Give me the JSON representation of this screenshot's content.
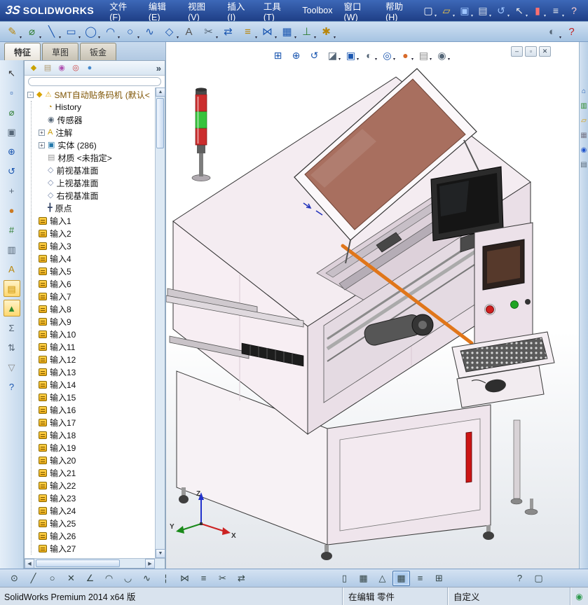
{
  "colors": {
    "titlebar_blue": "#2a4d9e",
    "toolbar_blue": "#b9cfe6",
    "viewport_bg": "#ffffff",
    "machine_pink": "#f4ecf1",
    "accent_orange": "#e0761a",
    "tower_red": "#cb2d2d",
    "tower_green": "#37c33c"
  },
  "titlebar": {
    "logo_mark": "3S",
    "logo_text": "SOLIDWORKS",
    "menus": [
      "文件(F)",
      "编辑(E)",
      "视图(V)",
      "插入(I)",
      "工具(T)",
      "Toolbox",
      "窗口(W)",
      "帮助(H)"
    ],
    "icons": [
      {
        "name": "new-document-icon",
        "glyph": "▢",
        "color": "#ffffff",
        "dd": true
      },
      {
        "name": "open-icon",
        "glyph": "▱",
        "color": "#f5c842",
        "dd": true
      },
      {
        "name": "save-icon",
        "glyph": "▣",
        "color": "#9cc4ff",
        "dd": true
      },
      {
        "name": "print-icon",
        "glyph": "▤",
        "color": "#d8e0ec",
        "dd": true
      },
      {
        "name": "undo-icon",
        "glyph": "↺",
        "color": "#9cc4ff",
        "dd": true
      },
      {
        "name": "select-icon",
        "glyph": "↖",
        "color": "#e8e8e8",
        "dd": true
      },
      {
        "name": "rebuild-icon",
        "glyph": "▮",
        "color": "#ff7070",
        "dd": true
      },
      {
        "name": "options-icon",
        "glyph": "≡",
        "color": "#f0f0f0",
        "dd": true
      },
      {
        "name": "help-badge-icon",
        "glyph": "?",
        "color": "#ffd0d0",
        "dd": false
      }
    ]
  },
  "toolbar2": {
    "icons": [
      {
        "name": "sketch-icon",
        "glyph": "✎",
        "color": "#b8860b",
        "dd": true
      },
      {
        "name": "smart-dimension-icon",
        "glyph": "⌀",
        "color": "#2e7d32",
        "dd": true
      },
      {
        "name": "line-icon",
        "glyph": "╲",
        "color": "#1a56b0",
        "dd": true
      },
      {
        "name": "rectangle-icon",
        "glyph": "▭",
        "color": "#1a56b0",
        "dd": true
      },
      {
        "name": "circle-icon",
        "glyph": "◯",
        "color": "#1a56b0",
        "dd": true
      },
      {
        "name": "arc-icon",
        "glyph": "◠",
        "color": "#1a56b0",
        "dd": true
      },
      {
        "name": "ellipse-icon",
        "glyph": "○",
        "color": "#1a56b0",
        "dd": true
      },
      {
        "name": "spline-icon",
        "glyph": "∿",
        "color": "#1a56b0",
        "dd": false
      },
      {
        "name": "polygon-icon",
        "glyph": "◇",
        "color": "#1a56b0",
        "dd": true
      },
      {
        "name": "text-icon",
        "glyph": "A",
        "color": "#555555",
        "dd": false
      },
      {
        "name": "trim-entities-icon",
        "glyph": "✂",
        "color": "#556677",
        "dd": true
      },
      {
        "name": "convert-entities-icon",
        "glyph": "⇄",
        "color": "#1a56b0",
        "dd": false
      },
      {
        "name": "offset-entities-icon",
        "glyph": "≡",
        "color": "#b8860b",
        "dd": true
      },
      {
        "name": "mirror-entities-icon",
        "glyph": "⋈",
        "color": "#1a56b0",
        "dd": true
      },
      {
        "name": "linear-pattern-icon",
        "glyph": "▦",
        "color": "#1a56b0",
        "dd": true
      },
      {
        "name": "display-relations-icon",
        "glyph": "⊥",
        "color": "#2e7d32",
        "dd": true
      },
      {
        "name": "quick-snaps-icon",
        "glyph": "✱",
        "color": "#b8860b",
        "dd": true
      }
    ],
    "right_icons": [
      {
        "name": "view-settings-icon",
        "glyph": "◐",
        "color": "#556677",
        "dd": true
      },
      {
        "name": "toolbox-help-icon",
        "glyph": "?",
        "color": "#c22222",
        "dd": false
      }
    ]
  },
  "tabs": [
    {
      "name": "tab-features",
      "label": "特征",
      "active": true
    },
    {
      "name": "tab-sketch",
      "label": "草图",
      "active": false
    },
    {
      "name": "tab-sheet-metal",
      "label": "钣金",
      "active": false
    }
  ],
  "left_strip": {
    "icons": [
      {
        "name": "select-arrow-icon",
        "glyph": "↖",
        "color": "#333333"
      },
      {
        "name": "sketch-entity-icon",
        "glyph": "▫",
        "color": "#1a56b0"
      },
      {
        "name": "dimension-icon",
        "glyph": "⌀",
        "color": "#2e7d32"
      },
      {
        "name": "view-orientation-icon",
        "glyph": "▣",
        "color": "#556677"
      },
      {
        "name": "zoom-icon",
        "glyph": "⊕",
        "color": "#1a56b0"
      },
      {
        "name": "rotate-view-icon",
        "glyph": "↺",
        "color": "#1a56b0"
      },
      {
        "name": "pan-icon",
        "glyph": "+",
        "color": "#556677"
      },
      {
        "name": "appearance-icon",
        "glyph": "●",
        "color": "#cc7a22"
      },
      {
        "name": "measure-icon",
        "glyph": "#",
        "color": "#2e7d32"
      },
      {
        "name": "section-view-icon",
        "glyph": "▥",
        "color": "#556677"
      },
      {
        "name": "annotation-icon",
        "glyph": "A",
        "color": "#b8860b"
      },
      {
        "name": "material-icon",
        "glyph": "▤",
        "color": "#c89000",
        "hl": true
      },
      {
        "name": "mass-properties-icon",
        "glyph": "▲",
        "color": "#2e8b2e",
        "hl": true
      },
      {
        "name": "equations-icon",
        "glyph": "Σ",
        "color": "#556677"
      },
      {
        "name": "configurations-icon",
        "glyph": "⇅",
        "color": "#556677"
      },
      {
        "name": "simulation-icon",
        "glyph": "▽",
        "color": "#888888"
      },
      {
        "name": "help-icon",
        "glyph": "?",
        "color": "#1a56b0"
      }
    ]
  },
  "tree_panel": {
    "header_icons": [
      {
        "name": "featuremanager-tab-icon",
        "glyph": "◆",
        "color": "#c9a200"
      },
      {
        "name": "propertymanager-tab-icon",
        "glyph": "▤",
        "color": "#b09a70"
      },
      {
        "name": "configurationmanager-tab-icon",
        "glyph": "◉",
        "color": "#b050b0"
      },
      {
        "name": "dimxpertmanager-tab-icon",
        "glyph": "◎",
        "color": "#cc4444"
      },
      {
        "name": "displaymanager-tab-icon",
        "glyph": "●",
        "color": "#4488cc"
      }
    ],
    "chevron": "»",
    "expander_glyph": "+",
    "root": {
      "collapse_glyph": "-",
      "icon_glyph": "◆",
      "warning_glyph": "⚠",
      "label": "SMT自动贴条码机",
      "suffix": "(默认<"
    },
    "items": [
      {
        "name": "tree-item-history",
        "label": "History",
        "glyph": "◔",
        "color": "#b8860b"
      },
      {
        "name": "tree-item-sensors",
        "label": "传感器",
        "glyph": "◉",
        "color": "#556677"
      },
      {
        "name": "tree-item-annotations",
        "label": "注解",
        "glyph": "A",
        "color": "#c99a00",
        "expand": true
      },
      {
        "name": "tree-item-solids",
        "label": "实体 (286)",
        "glyph": "▣",
        "color": "#2277aa",
        "expand": true
      },
      {
        "name": "tree-item-material",
        "label": "材质 <未指定>",
        "glyph": "▤",
        "color": "#999999"
      },
      {
        "name": "tree-item-front-plane",
        "label": "前视基准面",
        "glyph": "◇",
        "color": "#7788aa"
      },
      {
        "name": "tree-item-top-plane",
        "label": "上视基准面",
        "glyph": "◇",
        "color": "#7788aa"
      },
      {
        "name": "tree-item-right-plane",
        "label": "右视基准面",
        "glyph": "◇",
        "color": "#7788aa"
      },
      {
        "name": "tree-item-origin",
        "label": "原点",
        "glyph": "╋",
        "color": "#334466"
      }
    ],
    "inputs": [
      "输入1",
      "输入2",
      "输入3",
      "输入4",
      "输入5",
      "输入6",
      "输入7",
      "输入8",
      "输入9",
      "输入10",
      "输入11",
      "输入12",
      "输入13",
      "输入14",
      "输入15",
      "输入16",
      "输入17",
      "输入18",
      "输入19",
      "输入20",
      "输入21",
      "输入22",
      "输入23",
      "输入24",
      "输入25",
      "输入26",
      "输入27"
    ]
  },
  "viewport": {
    "headsup_icons": [
      {
        "name": "zoom-fit-icon",
        "glyph": "⊞",
        "color": "#1a56b0",
        "dd": false
      },
      {
        "name": "zoom-area-icon",
        "glyph": "⊕",
        "color": "#1a56b0",
        "dd": false
      },
      {
        "name": "previous-view-icon",
        "glyph": "↺",
        "color": "#1a56b0",
        "dd": false
      },
      {
        "name": "section-view-icon",
        "glyph": "◪",
        "color": "#556677",
        "dd": true
      },
      {
        "name": "view-orientation-icon",
        "glyph": "▣",
        "color": "#1a56b0",
        "dd": true
      },
      {
        "name": "display-style-icon",
        "glyph": "◐",
        "color": "#556677",
        "dd": true
      },
      {
        "name": "hide-show-icon",
        "glyph": "◎",
        "color": "#1a56b0",
        "dd": true
      },
      {
        "name": "edit-appearance-icon",
        "glyph": "●",
        "color": "#d86a2a",
        "dd": true
      },
      {
        "name": "apply-scene-icon",
        "glyph": "▤",
        "color": "#888888",
        "dd": true
      },
      {
        "name": "view-settings-icon",
        "glyph": "◉",
        "color": "#556677",
        "dd": true
      }
    ],
    "window_controls": [
      {
        "name": "minimize-window-icon",
        "glyph": "–"
      },
      {
        "name": "restore-window-icon",
        "glyph": "▫"
      },
      {
        "name": "close-window-icon",
        "glyph": "✕"
      }
    ],
    "triad": {
      "x": "X",
      "y": "Y",
      "z": "Z"
    }
  },
  "right_strip": {
    "icons": [
      {
        "name": "solidworks-resources-icon",
        "glyph": "⌂",
        "color": "#1a56b0"
      },
      {
        "name": "design-library-icon",
        "glyph": "▥",
        "color": "#2e8b2e"
      },
      {
        "name": "file-explorer-icon",
        "glyph": "▱",
        "color": "#d99a00"
      },
      {
        "name": "view-palette-icon",
        "glyph": "▦",
        "color": "#777788"
      },
      {
        "name": "appearances-icon",
        "glyph": "◉",
        "color": "#2255cc"
      },
      {
        "name": "custom-properties-icon",
        "glyph": "▤",
        "color": "#556677"
      }
    ]
  },
  "bottom_toolbar": {
    "left_icons": [
      {
        "name": "point-icon",
        "glyph": "⊙"
      },
      {
        "name": "line-icon",
        "glyph": "╱"
      },
      {
        "name": "circle-icon",
        "glyph": "○"
      },
      {
        "name": "erase-icon",
        "glyph": "✕"
      },
      {
        "name": "angle-icon",
        "glyph": "∠"
      },
      {
        "name": "arc-icon",
        "glyph": "◠"
      },
      {
        "name": "tangent-arc-icon",
        "glyph": "◡"
      },
      {
        "name": "spline-icon",
        "glyph": "∿"
      },
      {
        "name": "centerline-icon",
        "glyph": "¦"
      },
      {
        "name": "mirror-icon",
        "glyph": "⋈"
      },
      {
        "name": "offset-icon",
        "glyph": "≡"
      },
      {
        "name": "trim-icon",
        "glyph": "✂"
      },
      {
        "name": "convert-icon",
        "glyph": "⇄"
      }
    ],
    "right_icons": [
      {
        "name": "panel-left-icon",
        "glyph": "▯"
      },
      {
        "name": "grid-icon",
        "glyph": "▦"
      },
      {
        "name": "triad-toggle-icon",
        "glyph": "△"
      },
      {
        "name": "shaded-view-icon",
        "glyph": "▦",
        "active": true
      },
      {
        "name": "relations-icon",
        "glyph": "≡"
      },
      {
        "name": "grid-settings-icon",
        "glyph": "⊞"
      }
    ],
    "far_icons": [
      {
        "name": "help-icon",
        "glyph": "?"
      },
      {
        "name": "fullscreen-icon",
        "glyph": "▢"
      }
    ]
  },
  "statusbar": {
    "product": "SolidWorks Premium 2014 x64 版",
    "mode": "在编辑 零件",
    "custom": "自定义",
    "indicator_glyph": "◉"
  }
}
